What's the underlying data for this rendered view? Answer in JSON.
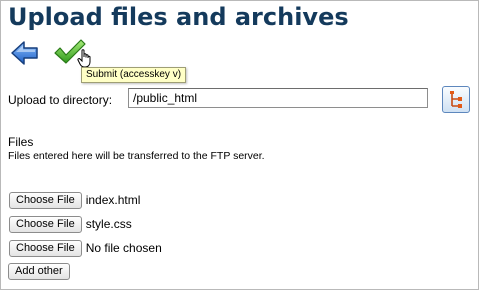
{
  "page": {
    "title": "Upload files and archives"
  },
  "toolbar": {
    "back_icon": "back-arrow-icon",
    "submit_icon": "checkmark-icon",
    "submit_tooltip": "Submit (accesskey v)"
  },
  "directory": {
    "label": "Upload to directory:",
    "value": "/public_html",
    "browse_icon": "directory-tree-icon"
  },
  "files": {
    "heading": "Files",
    "note": "Files entered here will be transferred to the FTP server.",
    "choose_label": "Choose File",
    "items": [
      {
        "name": "index.html"
      },
      {
        "name": "style.css"
      },
      {
        "name": "No file chosen"
      }
    ],
    "add_other_label": "Add other"
  },
  "colors": {
    "title": "#143a5c",
    "tooltip_bg": "#ffffc6",
    "arrow": "#2a6fd0",
    "check": "#4cb82a"
  }
}
